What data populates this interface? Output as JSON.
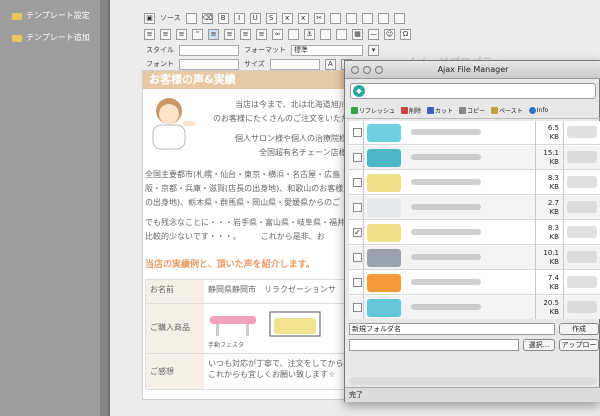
{
  "sidebar": {
    "items": [
      {
        "label": "テンプレート設定"
      },
      {
        "label": "テンプレート追加"
      }
    ]
  },
  "editor": {
    "toolbar": {
      "source_label": "ソース",
      "style_label": "スタイル",
      "format_label": "フォーマット",
      "format_value": "標準",
      "font_label": "フォント",
      "size_label": "サイズ"
    },
    "banner_title": "お客様の声&実績",
    "intro_lines": [
      "当店は今まで、北は北海道旭川市・釧",
      "のお客様にたくさんのご注文をいただ",
      "個人サロン様や個人の治療院様から整",
      "全国超有名チェーン店様からも"
    ],
    "area_lines": [
      "全国主要都市(札幌・仙台・東京・横浜・名古屋・広島",
      "阪・京都・兵庫・滋賀(店長の出身地)、和歌山のお客様",
      "の出身地)、栃木県・群馬県・岡山県・愛媛県からのご",
      "でも残念なことに・・・岩手県・富山県・岐阜県・福井",
      "比較的少ないです・・・。　　　これから是非、お"
    ],
    "section_title": "当店の実績例と、頂いた声を紹介します。",
    "table": {
      "name_label": "お名前",
      "name_value": "静岡県静岡市　リラクゼーションサ",
      "product_label": "ご購入商品",
      "product_caption": "手動フェスタ",
      "impression_label": "ご感想",
      "impression_lines": [
        "いつも対応が丁寧で、注文をしてから",
        "これからも宜しくお願い致します☆"
      ]
    },
    "ghost_panel_title": "イメージプロパティ"
  },
  "file_manager": {
    "title": "Ajax File Manager",
    "toolbar": [
      {
        "label": "リフレッシュ",
        "color": "#3aa04a"
      },
      {
        "label": "削除",
        "color": "#d04040"
      },
      {
        "label": "カット",
        "color": "#4060c0"
      },
      {
        "label": "コピー",
        "color": "#888888"
      },
      {
        "label": "ペースト",
        "color": "#c0a040"
      },
      {
        "label": "Info",
        "color": "#3070c0"
      }
    ],
    "files": [
      {
        "size": "6.5",
        "unit": "KB",
        "checked": false,
        "thumb": "#6ed0e0"
      },
      {
        "size": "15.1",
        "unit": "KB",
        "checked": false,
        "thumb": "#4fb5c8"
      },
      {
        "size": "8.3",
        "unit": "KB",
        "checked": false,
        "thumb": "#f1e18a"
      },
      {
        "size": "2.7",
        "unit": "KB",
        "checked": false,
        "thumb": "#dfe9ee"
      },
      {
        "size": "8.3",
        "unit": "KB",
        "checked": true,
        "thumb": "#f1e18a"
      },
      {
        "size": "10.1",
        "unit": "KB",
        "checked": false,
        "thumb": "#9aa4b0"
      },
      {
        "size": "7.4",
        "unit": "KB",
        "checked": false,
        "thumb": "#f59a3a"
      },
      {
        "size": "20.5",
        "unit": "KB",
        "checked": false,
        "thumb": "#62c8d8"
      }
    ],
    "new_folder_placeholder": "新規フォルダ名",
    "create_button": "作成",
    "browse_button": "選択...",
    "upload_button": "アップロー",
    "status": "完了"
  }
}
